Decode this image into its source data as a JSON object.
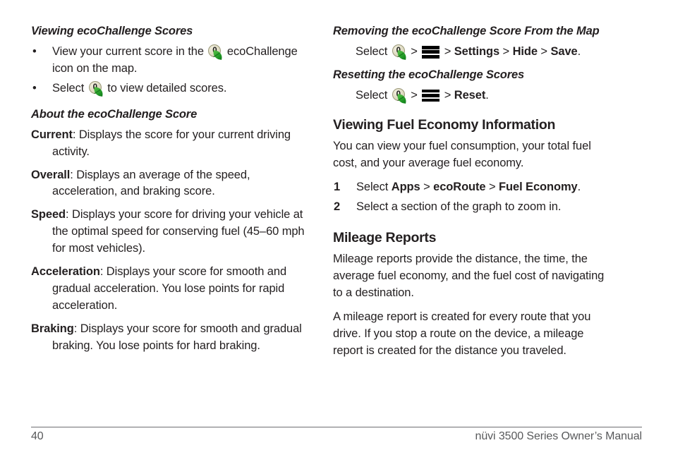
{
  "document": {
    "page_number": "40",
    "manual_title": "nüvi 3500 Series Owner’s Manual"
  },
  "icons": {
    "eco_challenge": "ecochallenge-score-icon",
    "eco_challenge_value": "0",
    "menu": "menu-icon"
  },
  "colors": {
    "text": "#231f20",
    "footer_text": "#58595b",
    "rule": "#6d6e71",
    "leaf_green": "#28a02a",
    "disc_beige": "#ddd9c0"
  },
  "left_column": {
    "section1": {
      "heading": "Viewing ecoChallenge Scores",
      "bullets": [
        {
          "marker": "•",
          "text_before_icon": "View your current score in the ",
          "has_icon": true,
          "text_after_icon": " ecoChallenge icon on the map."
        },
        {
          "marker": "•",
          "text_before_icon": "Select ",
          "has_icon": true,
          "text_after_icon": " to view detailed scores."
        }
      ]
    },
    "section2": {
      "heading": "About the ecoChallenge Score",
      "definitions": [
        {
          "term": "Current",
          "text": ": Displays the score for your current driving activity."
        },
        {
          "term": "Overall",
          "text": ": Displays an average of the speed, acceleration, and braking score."
        },
        {
          "term": "Speed",
          "text": ": Displays your score for driving your vehicle at the optimal speed for conserving fuel (45–60 mph for most vehicles)."
        },
        {
          "term": "Acceleration",
          "text": ": Displays your score for smooth and gradual acceleration. You lose points for rapid acceleration."
        },
        {
          "term": "Braking",
          "text": ": Displays your score for smooth and gradual braking. You lose points for hard braking."
        }
      ]
    }
  },
  "right_column": {
    "section1": {
      "heading": "Removing the ecoChallenge Score From the Map",
      "step": {
        "lead": "Select ",
        "sep1": " > ",
        "sep2": " > ",
        "item1": "Settings",
        "sep3": " > ",
        "item2": "Hide",
        "sep4": " > ",
        "item3": "Save",
        "period": "."
      }
    },
    "section2": {
      "heading": "Resetting the ecoChallenge Scores",
      "step": {
        "lead": "Select ",
        "sep1": " > ",
        "sep2": " > ",
        "item1": "Reset",
        "period": "."
      }
    },
    "section3": {
      "heading": "Viewing Fuel Economy Information",
      "intro": "You can view your fuel consumption, your total fuel cost, and your average fuel economy.",
      "steps": [
        {
          "number": "1",
          "lead": "Select ",
          "item1": "Apps",
          "sep1": " > ",
          "item2": "ecoRoute",
          "sep2": " > ",
          "item3": "Fuel Economy",
          "period": "."
        },
        {
          "number": "2",
          "text": "Select a section of the graph to zoom in."
        }
      ]
    },
    "section4": {
      "heading": "Mileage Reports",
      "paragraph1": "Mileage reports provide the distance, the time, the average fuel economy, and the fuel cost of navigating to a destination.",
      "paragraph2": "A mileage report is created for every route that you drive. If you stop a route on the device, a mileage report is created for the distance you traveled."
    }
  }
}
